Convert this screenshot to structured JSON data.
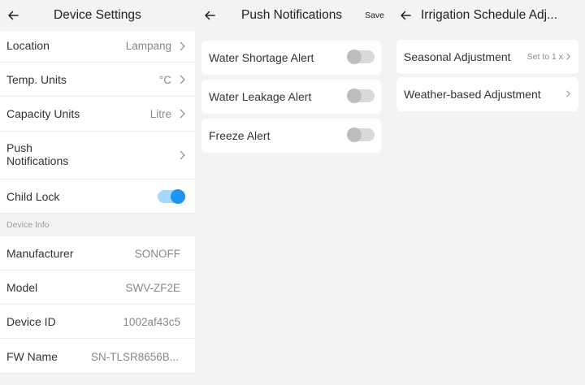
{
  "panel1": {
    "title": "Device Settings",
    "rows": [
      {
        "label": "Location",
        "value": "Lampang"
      },
      {
        "label": "Temp. Units",
        "value": "°C"
      },
      {
        "label": "Capacity Units",
        "value": "Litre"
      },
      {
        "label": "Push\nNotifications",
        "value": ""
      },
      {
        "label": "Child Lock",
        "toggle": true
      }
    ],
    "section": "Device Info",
    "info": [
      {
        "label": "Manufacturer",
        "value": "SONOFF"
      },
      {
        "label": "Model",
        "value": "SWV-ZF2E"
      },
      {
        "label": "Device ID",
        "value": "1002af43c5"
      },
      {
        "label": "FW Name",
        "value": "SN-TLSR8656B..."
      }
    ]
  },
  "panel2": {
    "title": "Push Notifications",
    "save_label": "Save",
    "items": [
      {
        "label": "Water Shortage Alert",
        "enabled": false
      },
      {
        "label": "Water Leakage Alert",
        "enabled": false
      },
      {
        "label": "Freeze Alert",
        "enabled": false
      }
    ]
  },
  "panel3": {
    "title": "Irrigation Schedule Adj...",
    "items": [
      {
        "label": "Seasonal Adjustment",
        "value": "Set to 1 x"
      },
      {
        "label": "Weather-based Adjustment",
        "value": ""
      }
    ]
  },
  "colors": {
    "accent": "#1e96f0",
    "toggle_track_on": "#a6d8fb",
    "toggle_off": "#d9d9d9"
  }
}
